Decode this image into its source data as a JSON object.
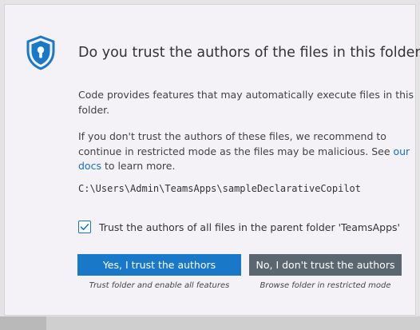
{
  "dialog": {
    "title": "Do you trust the authors of the files in this folder?",
    "paragraph1": "Code provides features that may automatically execute files in this folder.",
    "paragraph2_before_link": "If you don't trust the authors of these files, we recommend to continue in restricted mode as the files may be malicious. See ",
    "paragraph2_link": "our docs",
    "paragraph2_after_link": " to learn more.",
    "folder_path": "C:\\Users\\Admin\\TeamsApps\\sampleDeclarativeCopilot",
    "checkbox": {
      "label": "Trust the authors of all files in the parent folder 'TeamsApps'",
      "checked": true
    },
    "buttons": {
      "trust_label": "Yes, I trust the authors",
      "trust_subtitle": "Trust folder and enable all features",
      "distrust_label": "No, I don't trust the authors",
      "distrust_subtitle": "Browse folder in restricted mode"
    },
    "icon": "shield-lock-icon"
  },
  "colors": {
    "accent": "#1a78c8",
    "link": "#1a6fc9",
    "secondary_button": "#5b6770",
    "dialog_background": "#f4f2f6"
  }
}
